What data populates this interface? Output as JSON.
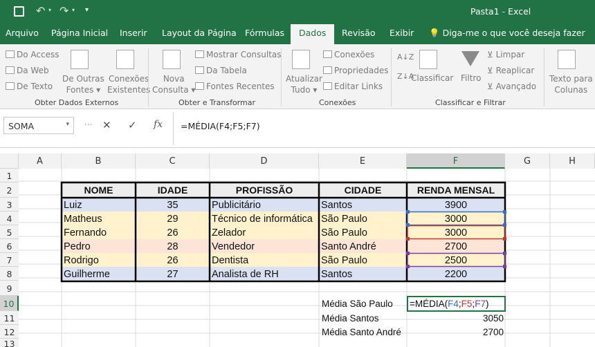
{
  "window": {
    "doc_title": "Pasta1",
    "app": "Excel",
    "title_sep": "-"
  },
  "tabs": [
    "Arquivo",
    "Página Inicial",
    "Inserir",
    "Layout da Página",
    "Fórmulas",
    "Dados",
    "Revisão",
    "Exibir"
  ],
  "active_tab": "Dados",
  "tell_me": "Diga-me o que você deseja fazer",
  "ribbon": {
    "external": {
      "access": "Do Access",
      "web": "Da Web",
      "text": "De Texto",
      "other1": "De Outras",
      "other2": "Fontes",
      "existing1": "Conexões",
      "existing2": "Existentes",
      "group": "Obter Dados Externos"
    },
    "transform": {
      "new1": "Nova",
      "new2": "Consulta",
      "show": "Mostrar Consultas",
      "table": "Da Tabela",
      "recent": "Fontes Recentes",
      "group": "Obter e Transformar"
    },
    "connections": {
      "refresh1": "Atualizar",
      "refresh2": "Tudo",
      "conn": "Conexões",
      "props": "Propriedades",
      "edit": "Editar Links",
      "group": "Conexões"
    },
    "sort": {
      "classify": "Classificar",
      "filter": "Filtro",
      "clear": "Limpar",
      "reapply": "Reaplicar",
      "advanced": "Avançado",
      "group": "Classificar e Filtrar"
    },
    "tools": {
      "text1": "Texto para",
      "text2": "Colunas"
    }
  },
  "name_box": "SOMA",
  "formula": "=MÉDIA(F4;F5;F7)",
  "columns": [
    "A",
    "B",
    "C",
    "D",
    "E",
    "F",
    "G",
    "H"
  ],
  "rows": [
    "1",
    "2",
    "3",
    "4",
    "5",
    "6",
    "7",
    "8",
    "9",
    "10",
    "11",
    "12",
    "13"
  ],
  "table": {
    "headers": [
      "NOME",
      "IDADE",
      "PROFISSÃO",
      "CIDADE",
      "RENDA MENSAL"
    ],
    "rows": [
      {
        "nome": "Luiz",
        "idade": "35",
        "prof": "Publicitário",
        "cidade": "Santos",
        "renda": "3900"
      },
      {
        "nome": "Matheus",
        "idade": "29",
        "prof": "Técnico de informática",
        "cidade": "São Paulo",
        "renda": "3000"
      },
      {
        "nome": "Fernando",
        "idade": "26",
        "prof": "Zelador",
        "cidade": "São Paulo",
        "renda": "3000"
      },
      {
        "nome": "Pedro",
        "idade": "28",
        "prof": "Vendedor",
        "cidade": "Santo André",
        "renda": "2700"
      },
      {
        "nome": "Rodrigo",
        "idade": "26",
        "prof": "Dentista",
        "cidade": "São Paulo",
        "renda": "2500"
      },
      {
        "nome": "Guilherme",
        "idade": "27",
        "prof": "Analista de RH",
        "cidade": "Santos",
        "renda": "2200"
      }
    ]
  },
  "summary": {
    "sp_label": "Média São Paulo",
    "sp_formula": {
      "pre": "=MÉDIA(",
      "a": "F4",
      ";1": ";",
      "b": "F5",
      ";2": ";",
      "c": "F7",
      "post": ")"
    },
    "santos_label": "Média Santos",
    "santos_value": "3050",
    "sa_label": "Média Santo André",
    "sa_value": "2700"
  },
  "colors": {
    "excel_green": "#217346",
    "row_blue": "#d9e1f2",
    "row_yellow": "#fff2cc",
    "row_orange": "#fce4d6",
    "hdr_gray": "#ededed",
    "ref_blue": "#3b6fc4",
    "ref_red": "#c0392b",
    "ref_purple": "#7b3fa0"
  }
}
